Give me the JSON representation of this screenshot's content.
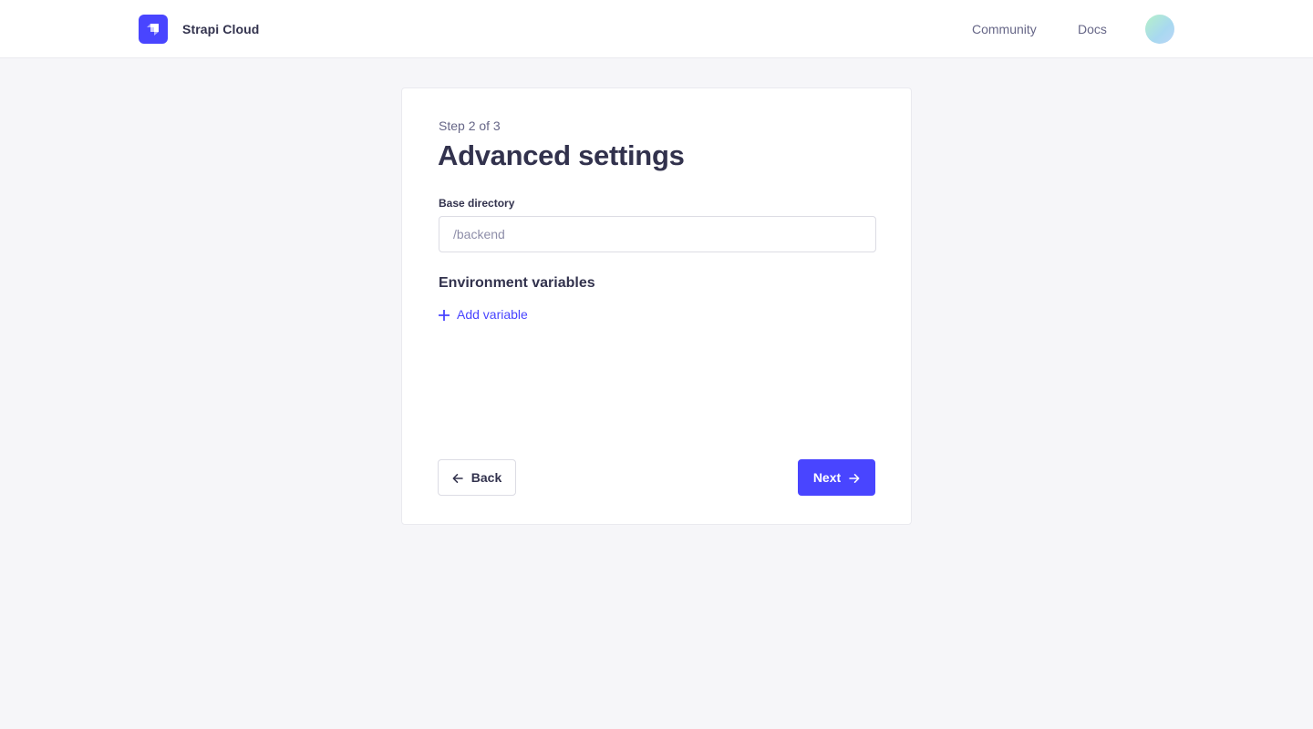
{
  "header": {
    "brand_name": "Strapi Cloud",
    "nav": {
      "community": "Community",
      "docs": "Docs"
    },
    "accent": "#4945ff"
  },
  "wizard": {
    "step_text": "Step 2 of 3",
    "title": "Advanced settings",
    "base_directory": {
      "label": "Base directory",
      "placeholder": "/backend",
      "value": ""
    },
    "env_section_title": "Environment variables",
    "add_variable_label": "Add variable",
    "back_label": "Back",
    "next_label": "Next"
  },
  "icons": {
    "logo": "strapi-logo-icon",
    "plus": "plus-icon",
    "back": "arrow-left-icon",
    "next": "arrow-right-icon"
  }
}
